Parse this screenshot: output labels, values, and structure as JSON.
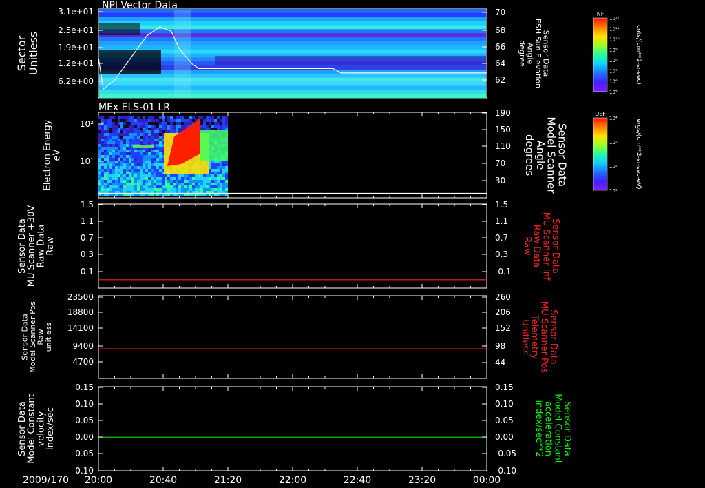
{
  "time_axis": {
    "date": "2009/170",
    "ticks": [
      "20:00",
      "20:40",
      "21:20",
      "22:00",
      "22:40",
      "23:20",
      "00:00"
    ]
  },
  "colorbars": [
    {
      "tag": "NF",
      "unit": "cnts/(cm**2-sr-sec)",
      "ticks": [
        "10¹²",
        "10¹¹",
        "10¹⁰",
        "10⁹",
        "10⁸",
        "10⁷",
        "10⁶",
        "10⁵"
      ]
    },
    {
      "tag": "DEF",
      "unit": "ergs/(cm**2-sr-sec-eV)",
      "ticks": [
        "10⁴",
        "10³",
        "10²",
        "10¹"
      ]
    }
  ],
  "chart_data": [
    {
      "type": "heatmap",
      "title": "NPI Vector Data",
      "ylabel": "Sector Unitless",
      "yticks": [
        "3.1e+01",
        "2.5e+01",
        "1.9e+01",
        "1.2e+01",
        "6.2e+00"
      ],
      "right_ylabel": "Sensor Data ESH Sun Elevation Angle degree",
      "right_yticks": [
        "70",
        "68",
        "66",
        "64",
        "62"
      ],
      "right_ylim": [
        60,
        70
      ],
      "overlay": {
        "name": "ESH Sun Elevation Angle",
        "color": "#ffffff",
        "x": [
          "20:00",
          "20:03",
          "20:10",
          "20:20",
          "20:30",
          "20:38",
          "20:45",
          "20:50",
          "20:58",
          "21:02",
          "22:25",
          "22:30",
          "00:00"
        ],
        "y": [
          64.5,
          61.0,
          62.0,
          64.5,
          67.0,
          68.0,
          67.5,
          65.5,
          63.8,
          63.3,
          63.3,
          62.8,
          62.8
        ]
      },
      "notes": "spectrogram; colour per NF colour bar"
    },
    {
      "type": "heatmap",
      "title": "MEx ELS-01 LR",
      "ylabel": "Electron Energy eV",
      "yticks": [
        "10²",
        "10¹"
      ],
      "right_ylabel": "Sensor Data Model Scanner Angle degrees",
      "right_yticks": [
        "190",
        "150",
        "110",
        "70",
        "30"
      ],
      "right_ylim": [
        0,
        190
      ],
      "data_range": [
        "20:00",
        "21:20"
      ],
      "overlay": {
        "name": "Model Scanner Angle",
        "color": "#ffffff",
        "x": [
          "20:00",
          "00:00"
        ],
        "y": [
          10,
          10
        ]
      },
      "notes": "spectrogram; colour per DEF colour bar"
    },
    {
      "type": "line",
      "ylabel": "Sensor Data MU Scanner +30V Raw Data Raw",
      "yticks": [
        "1.5",
        "1.1",
        "0.7",
        "0.3",
        "-0.1"
      ],
      "ylim": [
        -0.5,
        1.5
      ],
      "right_ylabel": "Sensor Data MU Scanner Inf Raw Data Raw",
      "right_yticks": [
        "1.5",
        "1.1",
        "0.7",
        "0.3",
        "-0.1"
      ],
      "right_color": "#ff2020",
      "series": [
        {
          "color": "#ff2020",
          "x": [
            "20:00",
            "00:00"
          ],
          "y": [
            -0.3,
            -0.3
          ]
        }
      ]
    },
    {
      "type": "line",
      "ylabel": "Sensor Data Model Scanner Pos Raw unitless",
      "yticks": [
        "23500",
        "18800",
        "14100",
        "9400",
        "4700"
      ],
      "ylim": [
        0,
        23500
      ],
      "right_ylabel": "Sensor Data MU Scanner Pos Telemetry Unitless",
      "right_yticks": [
        "260",
        "206",
        "152",
        "98",
        "44"
      ],
      "right_color": "#ff2020",
      "series": [
        {
          "color": "#ff2020",
          "x": [
            "20:00",
            "00:00"
          ],
          "y": [
            8400,
            8400
          ]
        }
      ]
    },
    {
      "type": "line",
      "ylabel": "Sensor Data Model Constant velocity index/sec",
      "yticks": [
        "0.15",
        "0.10",
        "0.05",
        "0.00",
        "-0.05",
        "-0.10"
      ],
      "ylim": [
        -0.1,
        0.15
      ],
      "right_ylabel": "Sensor Data Model Constant acceleration index/sec**2",
      "right_yticks": [
        "0.15",
        "0.10",
        "0.05",
        "0.00",
        "-0.05",
        "-0.10"
      ],
      "right_color": "#00ff00",
      "series": [
        {
          "color": "#00e000",
          "x": [
            "20:00",
            "00:00"
          ],
          "y": [
            0,
            0
          ]
        }
      ]
    }
  ]
}
